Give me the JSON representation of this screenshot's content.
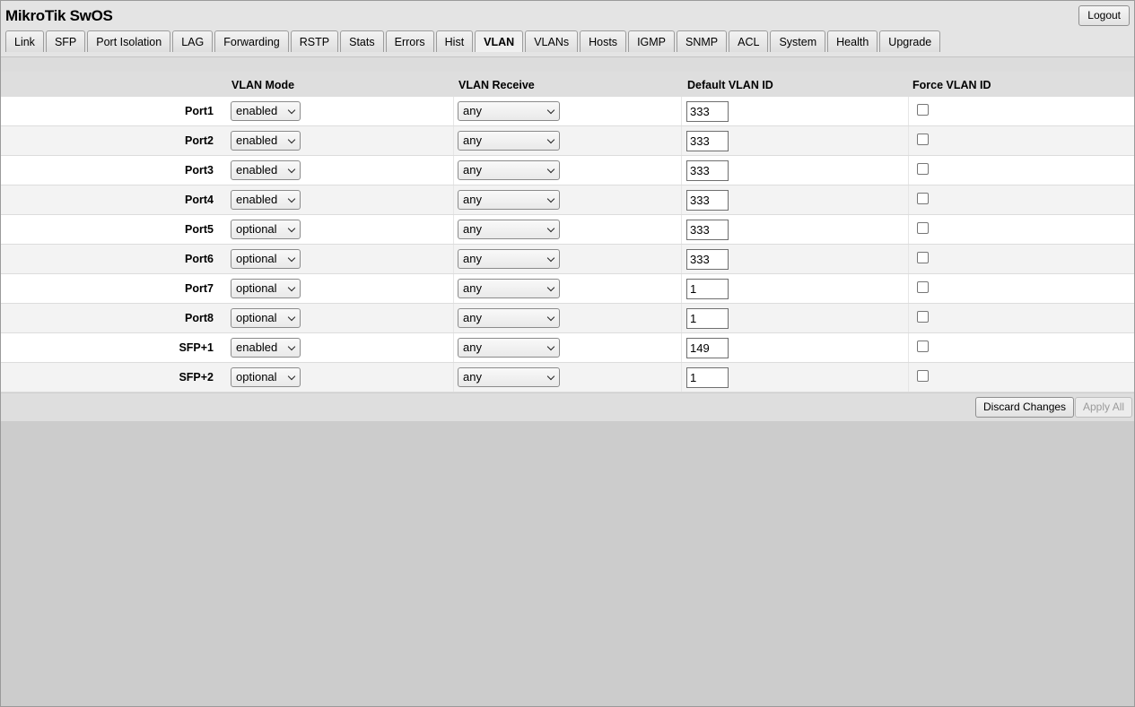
{
  "app": {
    "title": "MikroTik SwOS",
    "logout_label": "Logout"
  },
  "tabs": [
    "Link",
    "SFP",
    "Port Isolation",
    "LAG",
    "Forwarding",
    "RSTP",
    "Stats",
    "Errors",
    "Hist",
    "VLAN",
    "VLANs",
    "Hosts",
    "IGMP",
    "SNMP",
    "ACL",
    "System",
    "Health",
    "Upgrade"
  ],
  "active_tab": "VLAN",
  "table": {
    "headers": {
      "mode": "VLAN Mode",
      "receive": "VLAN Receive",
      "default_vlan_id": "Default VLAN ID",
      "force_vlan_id": "Force VLAN ID"
    },
    "rows": [
      {
        "port": "Port1",
        "mode": "enabled",
        "receive": "any",
        "vlan_id": "333",
        "force": false
      },
      {
        "port": "Port2",
        "mode": "enabled",
        "receive": "any",
        "vlan_id": "333",
        "force": false
      },
      {
        "port": "Port3",
        "mode": "enabled",
        "receive": "any",
        "vlan_id": "333",
        "force": false
      },
      {
        "port": "Port4",
        "mode": "enabled",
        "receive": "any",
        "vlan_id": "333",
        "force": false
      },
      {
        "port": "Port5",
        "mode": "optional",
        "receive": "any",
        "vlan_id": "333",
        "force": false
      },
      {
        "port": "Port6",
        "mode": "optional",
        "receive": "any",
        "vlan_id": "333",
        "force": false
      },
      {
        "port": "Port7",
        "mode": "optional",
        "receive": "any",
        "vlan_id": "1",
        "force": false
      },
      {
        "port": "Port8",
        "mode": "optional",
        "receive": "any",
        "vlan_id": "1",
        "force": false
      },
      {
        "port": "SFP+1",
        "mode": "enabled",
        "receive": "any",
        "vlan_id": "149",
        "force": false
      },
      {
        "port": "SFP+2",
        "mode": "optional",
        "receive": "any",
        "vlan_id": "1",
        "force": false
      }
    ]
  },
  "footer": {
    "discard_label": "Discard Changes",
    "apply_label": "Apply All"
  }
}
